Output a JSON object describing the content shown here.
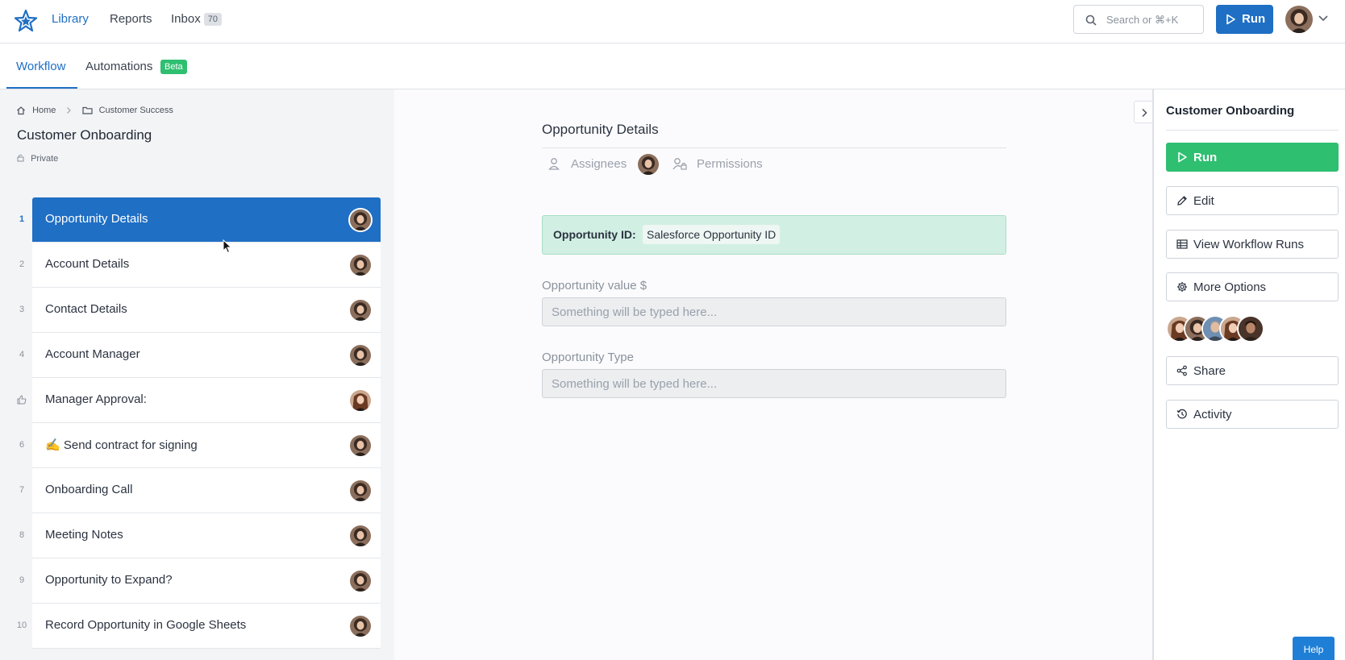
{
  "topnav": {
    "logo_icon": "star-icon",
    "links": [
      {
        "label": "Library"
      },
      {
        "label": "Reports"
      },
      {
        "label": "Inbox"
      }
    ],
    "inbox_count": "70",
    "search_placeholder": "Search or ⌘+K",
    "run_label": "Run"
  },
  "subnav": {
    "tabs": [
      {
        "label": "Workflow"
      },
      {
        "label": "Automations"
      }
    ],
    "beta_label": "Beta"
  },
  "sidebar": {
    "breadcrumb": [
      {
        "label": "Home",
        "icon": "home-icon"
      },
      {
        "label": "Customer Success",
        "icon": "folder-icon"
      }
    ],
    "title": "Customer Onboarding",
    "visibility": "Private",
    "steps": [
      {
        "num": "1",
        "label": "Opportunity Details",
        "active": true
      },
      {
        "num": "2",
        "label": "Account Details"
      },
      {
        "num": "3",
        "label": "Contact Details"
      },
      {
        "num": "4",
        "label": "Account Manager"
      },
      {
        "num": "",
        "icon": "thumbs-up-icon",
        "label": "Manager Approval:"
      },
      {
        "num": "6",
        "label": "✍️ Send contract for signing"
      },
      {
        "num": "7",
        "label": "Onboarding Call"
      },
      {
        "num": "8",
        "label": "Meeting Notes"
      },
      {
        "num": "9",
        "label": "Opportunity to Expand?"
      },
      {
        "num": "10",
        "label": "Record Opportunity in Google Sheets"
      }
    ]
  },
  "main": {
    "title": "Opportunity Details",
    "assignees_label": "Assignees",
    "permissions_label": "Permissions",
    "alert": {
      "key": "Opportunity ID:",
      "value": "Salesforce Opportunity ID"
    },
    "fields": [
      {
        "label": "Opportunity value $",
        "placeholder": "Something will be typed here..."
      },
      {
        "label": "Opportunity Type",
        "placeholder": "Something will be typed here..."
      }
    ]
  },
  "right_panel": {
    "title": "Customer Onboarding",
    "buttons": [
      {
        "label": "Run",
        "icon": "play-icon"
      },
      {
        "label": "Edit",
        "icon": "pencil-icon"
      },
      {
        "label": "View Workflow Runs",
        "icon": "table-icon"
      },
      {
        "label": "More Options",
        "icon": "gear-icon"
      },
      {
        "label": "Share",
        "icon": "share-icon"
      },
      {
        "label": "Activity",
        "icon": "history-icon"
      }
    ]
  },
  "help_label": "Help",
  "colors": {
    "primary": "#1f6fc4",
    "success": "#2fbf71",
    "alert_bg": "#d2efe4"
  }
}
